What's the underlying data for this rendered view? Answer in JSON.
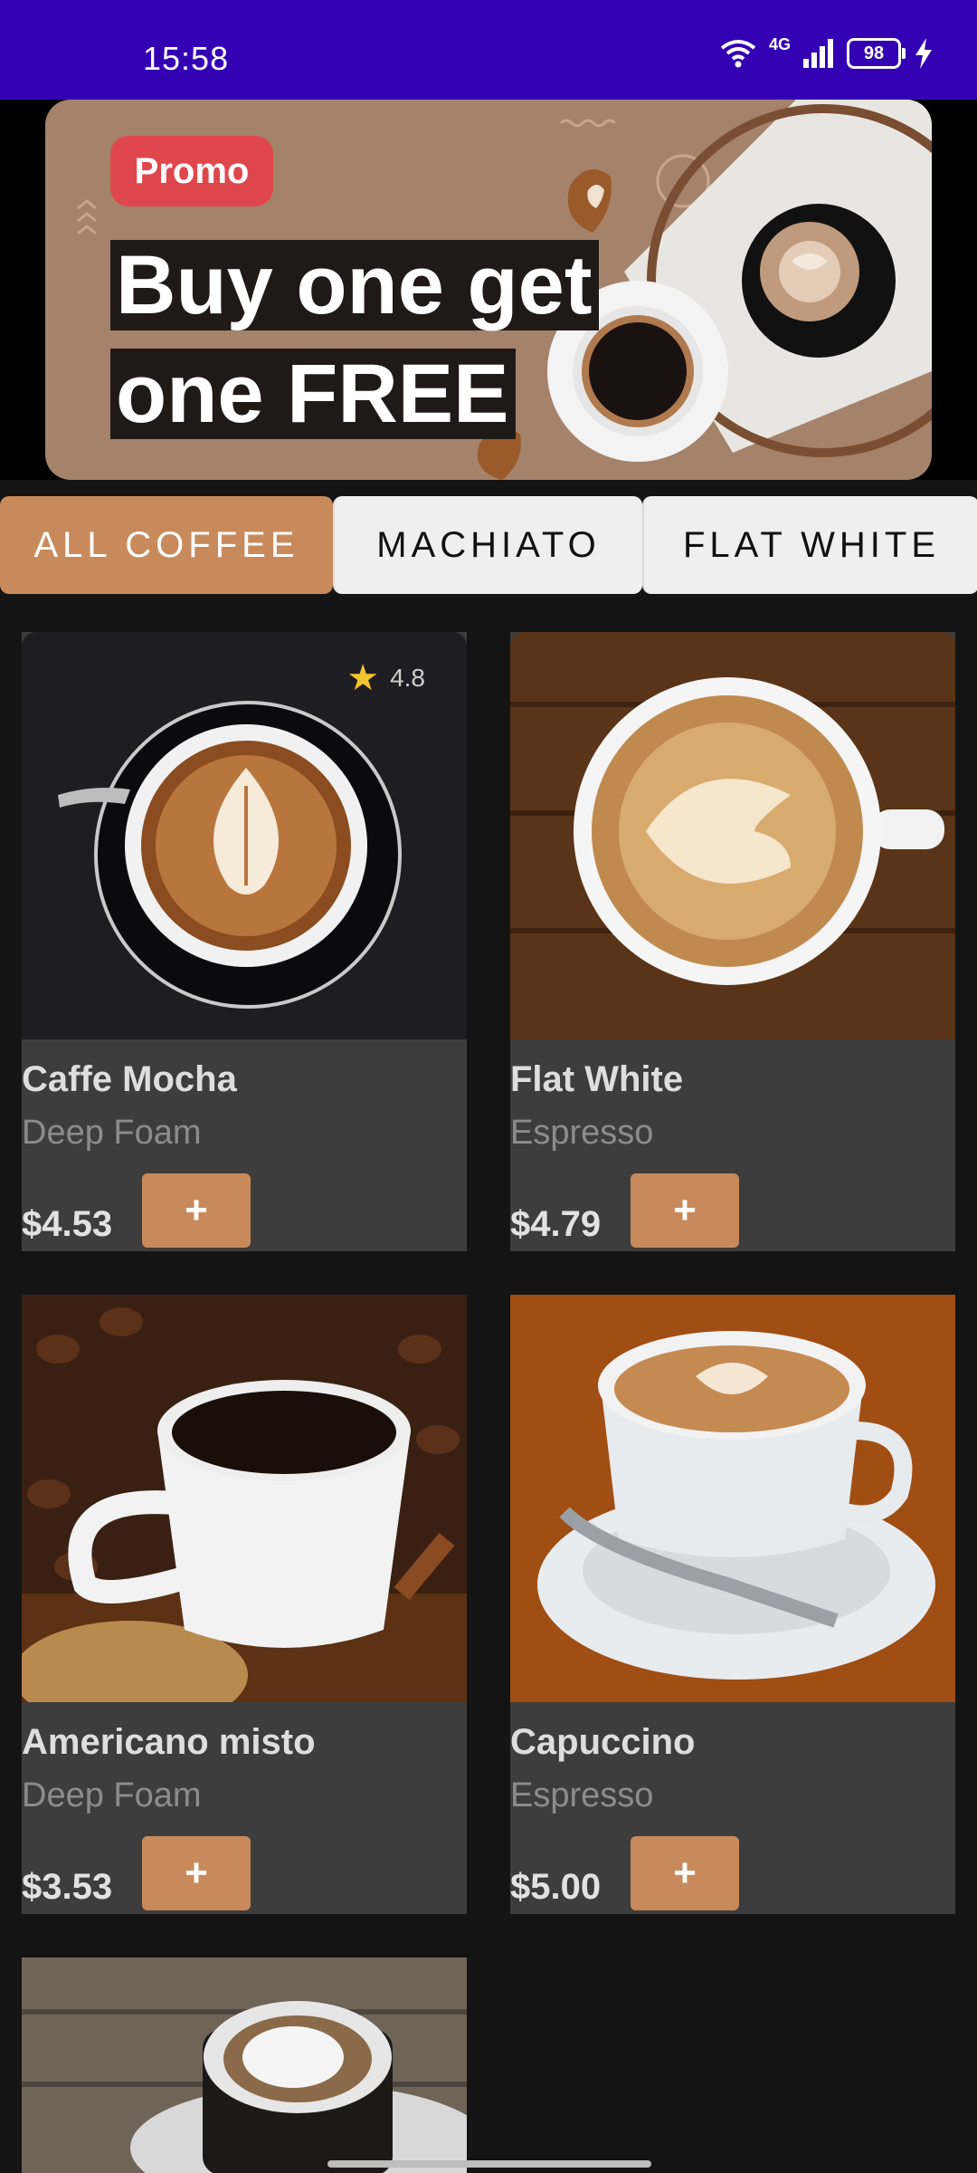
{
  "status_bar": {
    "time": "15:58",
    "network": "4G",
    "battery": "98",
    "icons": [
      "wifi-icon",
      "signal-icon",
      "battery-icon",
      "charging-icon"
    ]
  },
  "banner": {
    "badge": "Promo",
    "line1": "Buy one get",
    "line2": "one FREE"
  },
  "tabs": [
    {
      "label": "ALL COFFEE",
      "active": true
    },
    {
      "label": "MACHIATO",
      "active": false
    },
    {
      "label": "FLAT WHITE",
      "active": false
    }
  ],
  "products": [
    {
      "name": "Caffe Mocha",
      "subtitle": "Deep Foam",
      "price": "$4.53",
      "add": "+",
      "rating": "4.8"
    },
    {
      "name": "Flat White",
      "subtitle": "Espresso",
      "price": "$4.79",
      "add": "+"
    },
    {
      "name": "Americano misto",
      "subtitle": "Deep Foam",
      "price": "$3.53",
      "add": "+"
    },
    {
      "name": "Capuccino",
      "subtitle": "Espresso",
      "price": "$5.00",
      "add": "+"
    }
  ],
  "colors": {
    "status_bar": "#3300b4",
    "accent": "#c98a5b",
    "card_bg": "#3d3d3d",
    "page_bg": "#141414",
    "banner_bg": "#a5826a",
    "badge": "#e0474c"
  }
}
